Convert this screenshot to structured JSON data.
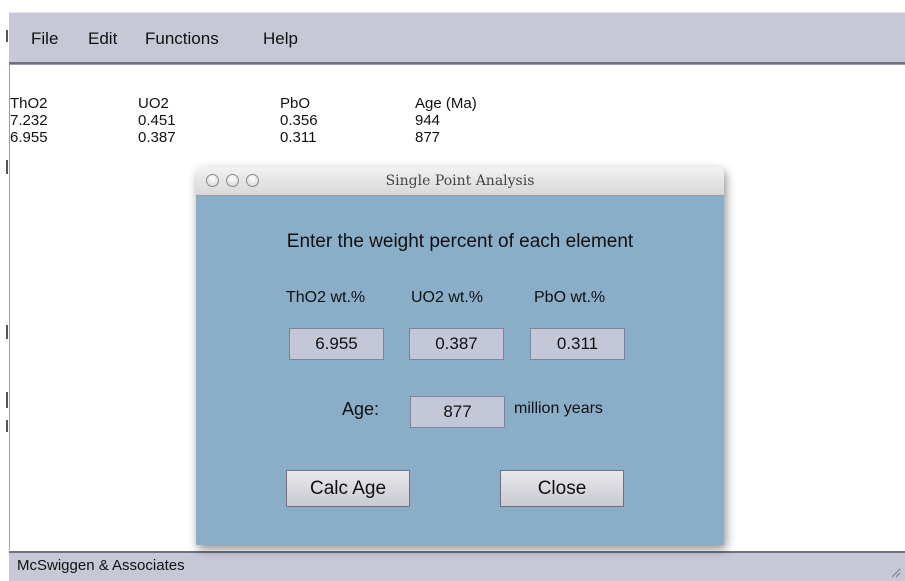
{
  "menu": {
    "file": "File",
    "edit": "Edit",
    "functions": "Functions",
    "help": "Help"
  },
  "results": {
    "headers": [
      "ThO2",
      "UO2",
      "PbO",
      "Age (Ma)"
    ],
    "rows": [
      [
        "7.232",
        "0.451",
        "0.356",
        "944"
      ],
      [
        "6.955",
        "0.387",
        "0.311",
        "877"
      ]
    ]
  },
  "dialog": {
    "title": "Single Point Analysis",
    "prompt": "Enter the weight percent of each element",
    "tho2_label": "ThO2 wt.%",
    "uo2_label": "UO2 wt.%",
    "pbo_label": "PbO wt.%",
    "tho2_value": "6.955",
    "uo2_value": "0.387",
    "pbo_value": "0.311",
    "age_label": "Age:",
    "age_value": "877",
    "age_units": "million years",
    "calc_button": "Calc Age",
    "close_button": "Close"
  },
  "status": {
    "text": "McSwiggen & Associates"
  }
}
